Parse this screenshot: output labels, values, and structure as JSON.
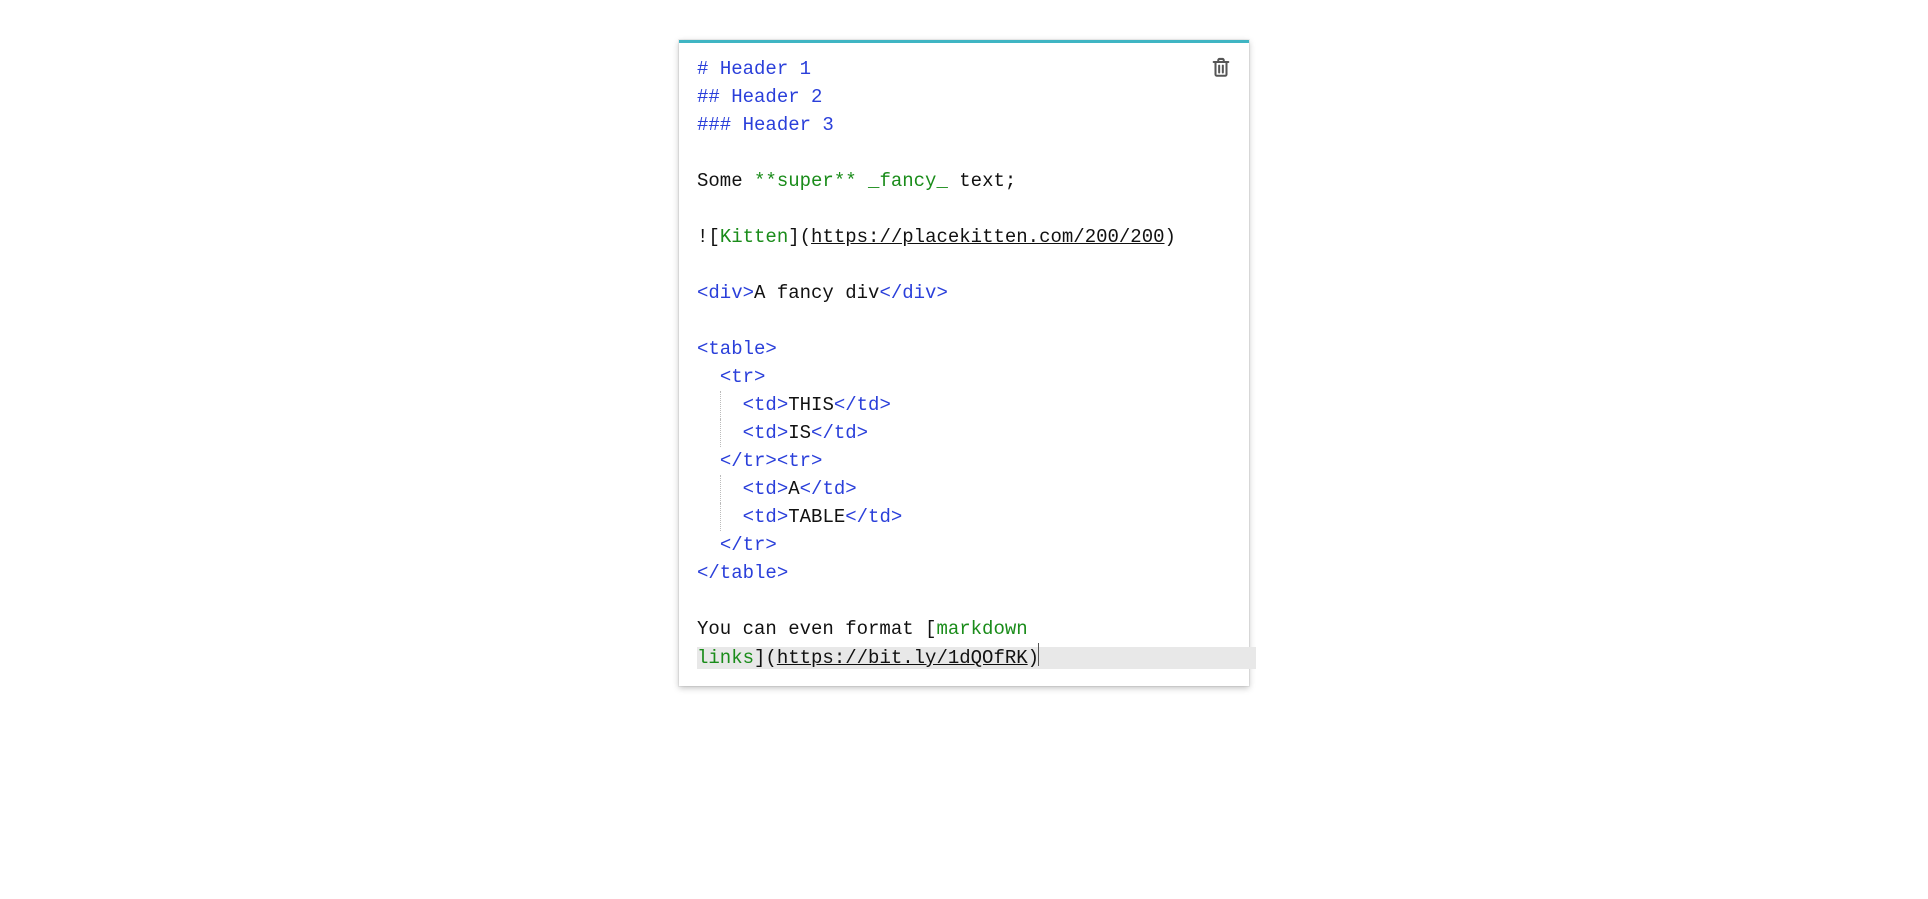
{
  "icons": {
    "trash": "trash-icon"
  },
  "editor": {
    "header1_prefix": "# ",
    "header1_text": "Header 1",
    "header2_prefix": "## ",
    "header2_text": "Header 2",
    "header3_prefix": "### ",
    "header3_text": "Header 3",
    "para1_a": "Some ",
    "para1_bold": "**super**",
    "para1_b": " ",
    "para1_italic": "_fancy_",
    "para1_c": " text;",
    "img_bang": "!",
    "img_lb": "[",
    "img_label": "Kitten",
    "img_rb": "]",
    "img_lp": "(",
    "img_url": "https://placekitten.com/200/200",
    "img_rp": ")",
    "div_open": "<div>",
    "div_text": "A fancy div",
    "div_close": "</div>",
    "table_open": "<table>",
    "tr_open": "<tr>",
    "td_open": "<td>",
    "td_close": "</td>",
    "cell1": "THIS",
    "cell2": "IS",
    "cell3": "A",
    "cell4": "TABLE",
    "tr_close": "</tr>",
    "trtr": "</tr><tr>",
    "table_close": "</table>",
    "link_a": "You can even format ",
    "link_lb": "[",
    "link_label_a": "markdown",
    "link_label_b": "links",
    "link_rb": "]",
    "link_lp": "(",
    "link_url": "https://bit.ly/1dQOfRK",
    "link_rp": ")"
  },
  "colors": {
    "accent_top": "#3FB5C3",
    "syntax_keyword": "#2a3fda",
    "syntax_emphasis": "#1a8c1a",
    "active_line_bg": "#e8e8e8"
  }
}
